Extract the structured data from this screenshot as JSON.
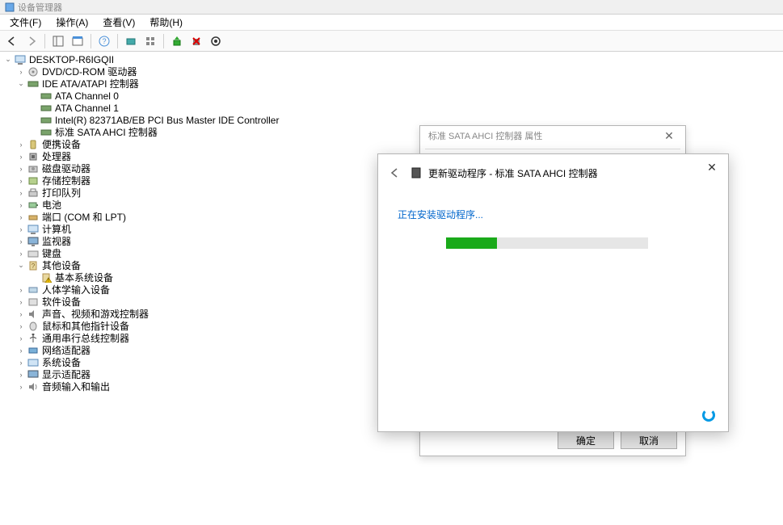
{
  "window": {
    "title": "设备管理器"
  },
  "menu": {
    "file": "文件(F)",
    "action": "操作(A)",
    "view": "查看(V)",
    "help": "帮助(H)"
  },
  "tree": {
    "root": "DESKTOP-R6IGQII",
    "cat_dvd": "DVD/CD-ROM 驱动器",
    "cat_ide": "IDE ATA/ATAPI 控制器",
    "ide_ch0": "ATA Channel 0",
    "ide_ch1": "ATA Channel 1",
    "ide_intel": "Intel(R) 82371AB/EB PCI Bus Master IDE Controller",
    "ide_sata": "标准 SATA AHCI 控制器",
    "cat_portable": "便携设备",
    "cat_cpu": "处理器",
    "cat_disk": "磁盘驱动器",
    "cat_storage": "存储控制器",
    "cat_printq": "打印队列",
    "cat_battery": "电池",
    "cat_ports": "端口 (COM 和 LPT)",
    "cat_computer": "计算机",
    "cat_monitor": "监视器",
    "cat_keyboard": "键盘",
    "cat_other": "其他设备",
    "other_base": "基本系统设备",
    "cat_hid": "人体学输入设备",
    "cat_soft": "软件设备",
    "cat_audio": "声音、视频和游戏控制器",
    "cat_mouse": "鼠标和其他指针设备",
    "cat_usb": "通用串行总线控制器",
    "cat_net": "网络适配器",
    "cat_sys": "系统设备",
    "cat_display": "显示适配器",
    "cat_audioio": "音频输入和输出"
  },
  "props": {
    "title": "标准 SATA AHCI 控制器 属性",
    "ok": "确定",
    "cancel": "取消"
  },
  "wizard": {
    "title": "更新驱动程序 - 标准 SATA AHCI 控制器",
    "status": "正在安装驱动程序...",
    "progress_percent": 25
  }
}
